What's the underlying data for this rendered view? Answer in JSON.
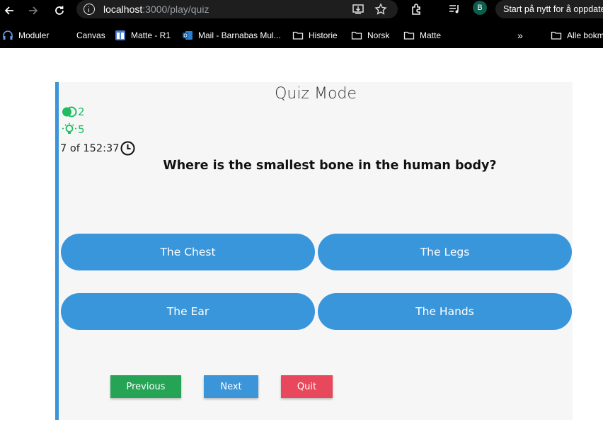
{
  "browser": {
    "url_host": "localhost",
    "url_path": ":3000/play/quiz",
    "profile_initial": "B",
    "restart_label": "Start på nytt for å oppdatere"
  },
  "bookmarks": [
    {
      "label": "Moduler",
      "icon": "headset-icon"
    },
    {
      "label": "Canvas",
      "icon": "blank-icon"
    },
    {
      "label": "Matte - R1",
      "icon": "page-icon"
    },
    {
      "label": "Mail - Barnabas Mul...",
      "icon": "outlook-icon"
    },
    {
      "label": "Historie",
      "icon": "folder-icon"
    },
    {
      "label": "Norsk",
      "icon": "folder-icon"
    },
    {
      "label": "Matte",
      "icon": "folder-icon"
    },
    {
      "label": "Alle bokm",
      "icon": "folder-icon"
    }
  ],
  "quiz": {
    "title": "Quiz Mode",
    "fifty_fifty_count": "2",
    "hints_count": "5",
    "progress": "7 of 15",
    "timer": "2:37",
    "question": "Where is the smallest bone in the human body?",
    "options": [
      "The Chest",
      "The Legs",
      "The Ear",
      "The Hands"
    ],
    "buttons": {
      "previous": "Previous",
      "next": "Next",
      "quit": "Quit"
    }
  },
  "colors": {
    "accent_blue": "#3a96db",
    "previous_green": "#26a455",
    "next_blue": "#3b95d8",
    "quit_red": "#e8485c",
    "stat_green": "#1fbd62"
  }
}
